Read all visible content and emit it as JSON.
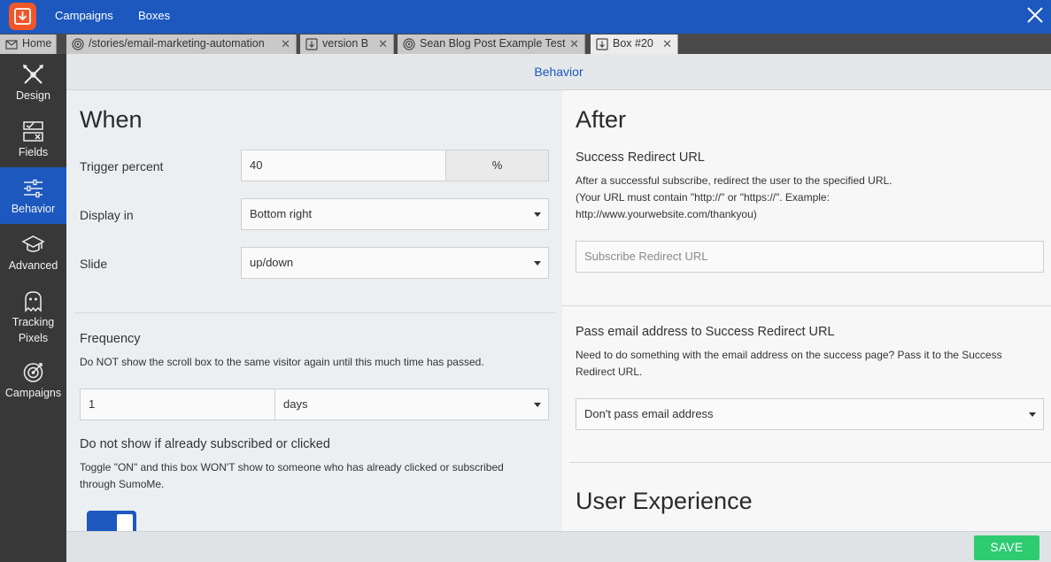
{
  "colors": {
    "brand_blue": "#1c58be",
    "logo_orange": "#f0562a",
    "save_green": "#2ecc71",
    "sidebar_bg": "#383838"
  },
  "topbar": {
    "logo_icon": "download-arrow-icon",
    "nav": [
      "Campaigns",
      "Boxes"
    ],
    "close_icon": "close-icon"
  },
  "tabs": [
    {
      "label": "Home",
      "icon": "mail-icon",
      "closable": false,
      "active": false
    },
    {
      "label": "/stories/email-marketing-automation",
      "icon": "target-icon",
      "closable": true,
      "active": false
    },
    {
      "label": "version B",
      "icon": "download-box-icon",
      "closable": true,
      "active": false
    },
    {
      "label": "Sean Blog Post Example Test",
      "icon": "target-icon",
      "closable": true,
      "active": false
    },
    {
      "label": "Box #20",
      "icon": "download-box-icon",
      "closable": true,
      "active": true
    }
  ],
  "sidebar": {
    "items": [
      {
        "label": "Design",
        "icon": "design-tools-icon"
      },
      {
        "label": "Fields",
        "icon": "fields-checkbox-icon"
      },
      {
        "label": "Behavior",
        "icon": "sliders-icon",
        "active": true
      },
      {
        "label": "Advanced",
        "icon": "graduation-cap-icon"
      },
      {
        "label_line1": "Tracking",
        "label_line2": "Pixels",
        "icon": "ghost-icon"
      },
      {
        "label": "Campaigns",
        "icon": "target-icon"
      }
    ]
  },
  "header": {
    "title": "Behavior"
  },
  "when": {
    "heading": "When",
    "trigger_label": "Trigger percent",
    "trigger_value": "40",
    "trigger_unit": "%",
    "display_label": "Display in",
    "display_value": "Bottom right",
    "slide_label": "Slide",
    "slide_value": "up/down",
    "frequency_heading": "Frequency",
    "frequency_help": "Do NOT show the scroll box to the same visitor again until this much time has passed.",
    "frequency_value": "1",
    "frequency_unit": "days",
    "subscribed_heading": "Do not show if already subscribed or clicked",
    "subscribed_help_line1": "Toggle \"ON\" and this box WON'T show to someone who has already clicked or subscribed",
    "subscribed_help_line2": "through SumoMe.",
    "subscribed_toggle_on": true
  },
  "after": {
    "heading": "After",
    "redirect_heading": "Success Redirect URL",
    "redirect_help_line1": "After a successful subscribe, redirect the user to the specified URL.",
    "redirect_help_line2": "(Your URL must contain \"http://\" or \"https://\". Example:",
    "redirect_help_line3": "http://www.yourwebsite.com/thankyou)",
    "redirect_placeholder": "Subscribe Redirect URL",
    "pass_heading": "Pass email address to Success Redirect URL",
    "pass_help_line1": "Need to do something with the email address on the success page? Pass it to the Success",
    "pass_help_line2": "Redirect URL.",
    "pass_value": "Don't pass email address",
    "ux_heading": "User Experience"
  },
  "footer": {
    "save_label": "SAVE"
  }
}
